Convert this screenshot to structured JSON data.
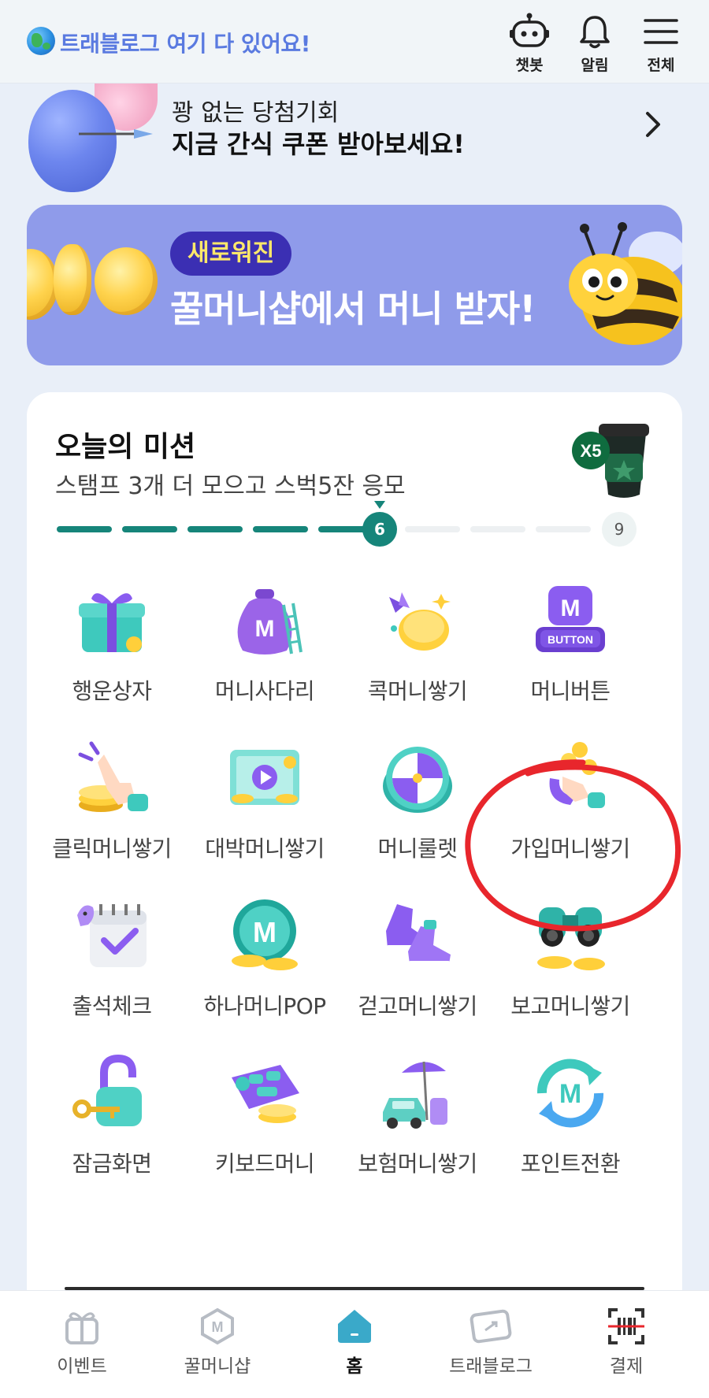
{
  "header": {
    "slogan": "트래블로그 여기 다 있어요!",
    "actions": [
      {
        "label": "챗봇",
        "icon": "robot-icon"
      },
      {
        "label": "알림",
        "icon": "bell-icon"
      },
      {
        "label": "전체",
        "icon": "menu-icon"
      }
    ]
  },
  "promo": {
    "line1": "꽝 없는 당첨기회",
    "line2": "지금 간식 쿠폰 받아보세요!"
  },
  "honey_banner": {
    "badge": "새로워진",
    "headline": "꿀머니샵에서 머니 받자!"
  },
  "mission": {
    "title": "오늘의 미션",
    "subtitle": "스탬프 3개 더 모으고 스벅5잔 응모",
    "reward_badge": "X5",
    "progress": {
      "current": 6,
      "total": 9
    },
    "items": [
      {
        "label": "행운상자",
        "icon": "gift-box-icon"
      },
      {
        "label": "머니사다리",
        "icon": "money-bag-ladder-icon"
      },
      {
        "label": "콕머니쌓기",
        "icon": "coin-poke-icon"
      },
      {
        "label": "머니버튼",
        "icon": "money-button-icon"
      },
      {
        "label": "클릭머니쌓기",
        "icon": "click-hand-icon"
      },
      {
        "label": "대박머니쌓기",
        "icon": "video-coins-icon"
      },
      {
        "label": "머니룰렛",
        "icon": "roulette-icon"
      },
      {
        "label": "가입머니쌓기",
        "icon": "signup-coins-icon"
      },
      {
        "label": "출석체크",
        "icon": "calendar-check-icon"
      },
      {
        "label": "하나머니POP",
        "icon": "money-pop-icon"
      },
      {
        "label": "걷고머니쌓기",
        "icon": "sneakers-icon"
      },
      {
        "label": "보고머니쌓기",
        "icon": "binoculars-icon"
      },
      {
        "label": "잠금화면",
        "icon": "padlock-key-icon"
      },
      {
        "label": "키보드머니",
        "icon": "keyboard-icon"
      },
      {
        "label": "보험머니쌓기",
        "icon": "insurance-car-icon"
      },
      {
        "label": "포인트전환",
        "icon": "point-exchange-icon"
      }
    ]
  },
  "bottom_nav": [
    {
      "label": "이벤트",
      "icon": "gift-icon"
    },
    {
      "label": "꿀머니샵",
      "icon": "money-shop-icon"
    },
    {
      "label": "홈",
      "icon": "home-icon",
      "active": true
    },
    {
      "label": "트래블로그",
      "icon": "travel-card-icon"
    },
    {
      "label": "결제",
      "icon": "barcode-scan-icon"
    }
  ],
  "colors": {
    "accent": "#16857a",
    "banner": "#8f9bea",
    "badge": "#3b2fb3",
    "annotation": "#e8262c"
  }
}
